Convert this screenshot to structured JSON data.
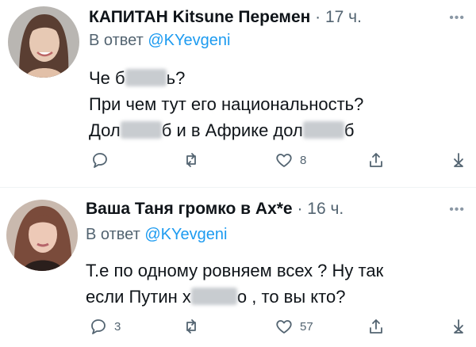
{
  "tweets": [
    {
      "author": "КАПИТАН Kitsune Перемен",
      "time": "· 17 ч.",
      "reply_prefix": "В ответ",
      "mention": "@KYevgeni",
      "lines": [
        {
          "a": "Че б",
          "b": "ь?"
        },
        {
          "a": "При чем тут его национальность?"
        },
        {
          "a": "Дол",
          "b": "б и в Африке дол",
          "c": "б"
        }
      ],
      "counts": {
        "reply": "",
        "retweet": "",
        "like": "8"
      },
      "colors": {
        "avatar_bg": "#5a4a40",
        "avatar_face": "#e7c9b4"
      }
    },
    {
      "author": "Ваша Таня громко в Ах*е",
      "time": "· 16 ч.",
      "reply_prefix": "В ответ",
      "mention": "@KYevgeni",
      "lines": [
        {
          "a": "Т.е по одному ровняем всех ? Ну так"
        },
        {
          "a": "если Путин х",
          "b": "о , то вы кто?"
        }
      ],
      "counts": {
        "reply": "3",
        "retweet": "",
        "like": "57"
      },
      "colors": {
        "avatar_bg": "#7a4b3b",
        "avatar_face": "#edc9b7"
      }
    }
  ],
  "icons": [
    "reply-icon",
    "retweet-icon",
    "like-icon",
    "share-icon",
    "download-icon",
    "more-icon"
  ],
  "colors": {
    "mention": "#1d9bf0",
    "muted": "#536471",
    "text": "#0f1419"
  }
}
